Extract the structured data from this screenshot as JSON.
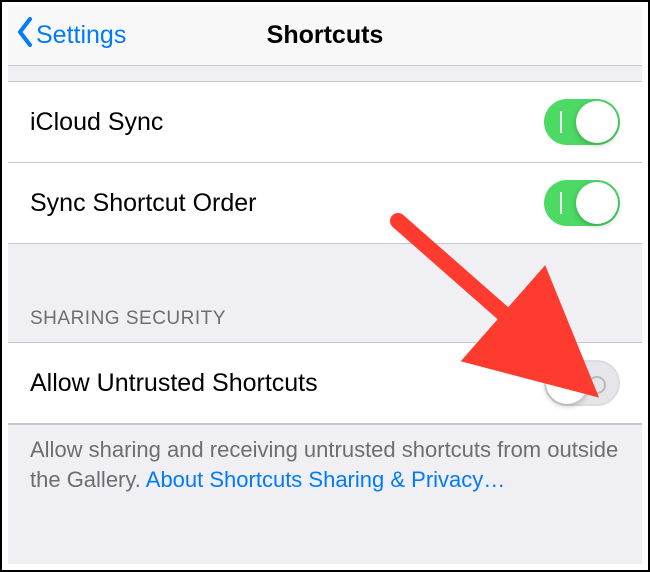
{
  "navbar": {
    "back_label": "Settings",
    "title": "Shortcuts"
  },
  "settings": {
    "icloud_sync": {
      "label": "iCloud Sync",
      "on": true
    },
    "sync_order": {
      "label": "Sync Shortcut Order",
      "on": true
    }
  },
  "security_section": {
    "header": "SHARING SECURITY",
    "allow_untrusted": {
      "label": "Allow Untrusted Shortcuts",
      "on": false
    },
    "footer_text": "Allow sharing and receiving untrusted shortcuts from outside the Gallery. ",
    "footer_link": "About Shortcuts Sharing & Privacy…"
  },
  "annotation": {
    "arrow_color": "#ff3b30"
  }
}
